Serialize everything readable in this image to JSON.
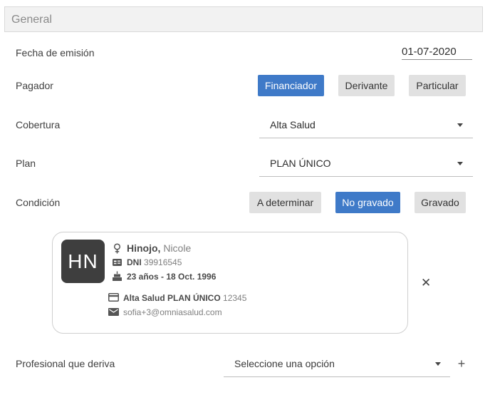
{
  "section": {
    "title": "General"
  },
  "fecha": {
    "label": "Fecha de emisión",
    "value": "01-07-2020"
  },
  "pagador": {
    "label": "Pagador",
    "options": [
      "Financiador",
      "Derivante",
      "Particular"
    ],
    "selected": "Financiador"
  },
  "cobertura": {
    "label": "Cobertura",
    "value": "Alta Salud"
  },
  "plan": {
    "label": "Plan",
    "value": "PLAN ÚNICO"
  },
  "condicion": {
    "label": "Condición",
    "options": [
      "A determinar",
      "No gravado",
      "Gravado"
    ],
    "selected": "No gravado"
  },
  "patient": {
    "initials": "HN",
    "last_name": "Hinojo,",
    "first_name": "Nicole",
    "dni_label": "DNI",
    "dni": "39916545",
    "age_birth": "23 años - 18 Oct. 1996",
    "coverage_plan": "Alta Salud PLAN ÚNICO",
    "member_number": "12345",
    "email": "sofia+3@omniasalud.com"
  },
  "remove_icon": "close-icon",
  "profesional": {
    "label": "Profesional que deriva",
    "placeholder": "Seleccione una opción",
    "add_icon": "plus-icon"
  },
  "colors": {
    "accent": "#3f7ac8",
    "button": "#e1e1e1",
    "avatar": "#3e3e3e"
  }
}
